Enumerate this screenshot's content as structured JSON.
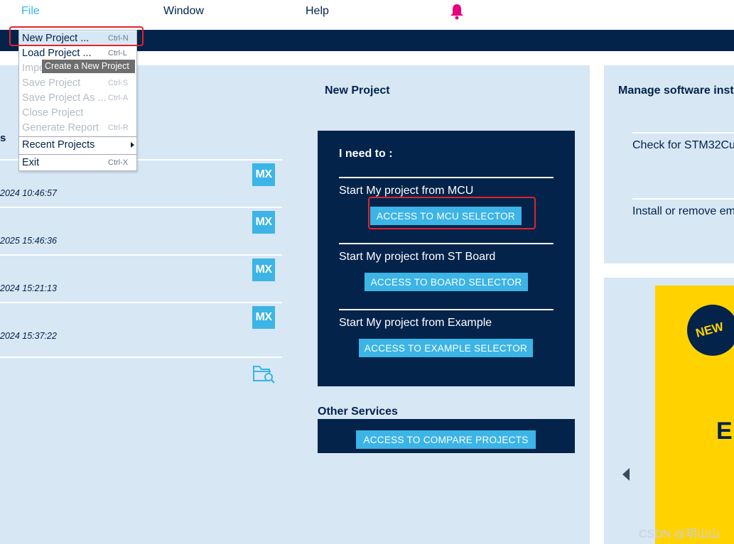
{
  "menubar": {
    "file": "File",
    "window": "Window",
    "help": "Help",
    "bell_icon": "bell-icon",
    "bell_color": "#e6007e"
  },
  "file_menu": {
    "items": [
      {
        "label": "New Project ...",
        "shortcut": "Ctrl-N",
        "enabled": true
      },
      {
        "label": "Load Project ...",
        "shortcut": "Ctrl-L",
        "enabled": true
      },
      {
        "label": "Impo",
        "shortcut": "",
        "enabled": false
      },
      {
        "label": "Save Project",
        "shortcut": "Ctrl-S",
        "enabled": false
      },
      {
        "label": "Save Project As ...",
        "shortcut": "Ctrl-A",
        "enabled": false
      },
      {
        "label": "Close Project",
        "shortcut": "",
        "enabled": false
      },
      {
        "label": "Generate Report",
        "shortcut": "Ctrl-R",
        "enabled": false
      }
    ],
    "recent": "Recent Projects",
    "exit": {
      "label": "Exit",
      "shortcut": "Ctrl-X"
    },
    "tooltip": "Create a New Project"
  },
  "recent_projects": {
    "heading_fragment": "s",
    "mx_label": "MX",
    "entries": [
      {
        "date": "2024 10:46:57"
      },
      {
        "date": "2025 15:46:36"
      },
      {
        "date": "2024 15:21:13"
      },
      {
        "date": "2024 15:37:22"
      }
    ],
    "open_icon": "folder-search-icon"
  },
  "new_project": {
    "title": "New Project",
    "need_to": "I need to :",
    "sections": [
      {
        "label": "Start My project from MCU",
        "button": "ACCESS TO MCU SELECTOR"
      },
      {
        "label": "Start My project from ST Board",
        "button": "ACCESS TO BOARD SELECTOR"
      },
      {
        "label": "Start My project from Example",
        "button": "ACCESS TO EXAMPLE SELECTOR"
      }
    ]
  },
  "other_services": {
    "title": "Other Services",
    "button": "ACCESS TO COMPARE PROJECTS"
  },
  "manage_software": {
    "title": "Manage software inst",
    "items": [
      "Check for STM32Cu",
      "Install or remove em"
    ]
  },
  "promo": {
    "badge": "NEW",
    "letter": "E"
  },
  "watermark": "CSDN @玥山山",
  "colors": {
    "navy": "#03234b",
    "light_blue": "#3cb4e6",
    "panel": "#d7e7f4",
    "highlight_red": "#e0242c",
    "promo_yellow": "#ffd200"
  }
}
